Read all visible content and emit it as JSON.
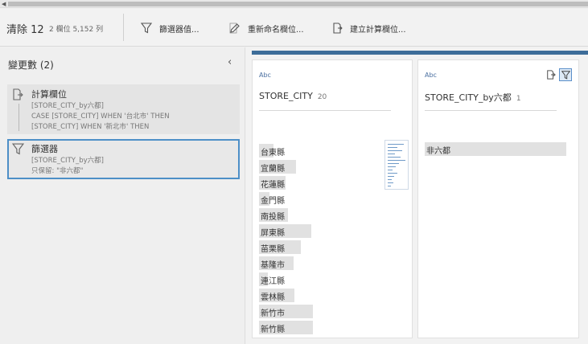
{
  "toolbar": {
    "title": "清除 12",
    "meta": "2 欄位  5,152 列",
    "buttons": [
      {
        "label": "篩選器值...",
        "icon": "funnel-icon"
      },
      {
        "label": "重新命名欄位...",
        "icon": "pencil-icon"
      },
      {
        "label": "建立計算欄位...",
        "icon": "calc-field-icon"
      }
    ]
  },
  "sidebar": {
    "title": "變更數 (2)",
    "collapse_glyph": "‹",
    "changes": [
      {
        "title": "計算欄位",
        "icon": "calc-field-icon",
        "lines": [
          "[STORE_CITY_by六都]",
          "CASE [STORE_CITY] WHEN '台北市' THEN",
          "[STORE_CITY] WHEN '新北市' THEN"
        ]
      },
      {
        "title": "篩選器",
        "icon": "funnel-icon",
        "lines": [
          "[STORE_CITY_by六都]",
          "只保留: \"非六都\""
        ]
      }
    ]
  },
  "columns": [
    {
      "type_label": "Abc",
      "name": "STORE_CITY",
      "count": "20",
      "rows": [
        {
          "label": "台東縣",
          "share": 0.16
        },
        {
          "label": "宜蘭縣",
          "share": 0.4
        },
        {
          "label": "花蓮縣",
          "share": 0.29
        },
        {
          "label": "金門縣",
          "share": 0.11
        },
        {
          "label": "南投縣",
          "share": 0.32
        },
        {
          "label": "屏東縣",
          "share": 0.57
        },
        {
          "label": "苗栗縣",
          "share": 0.46
        },
        {
          "label": "基隆市",
          "share": 0.38
        },
        {
          "label": "連江縣",
          "share": 0.1
        },
        {
          "label": "雲林縣",
          "share": 0.39
        },
        {
          "label": "新竹市",
          "share": 0.59
        },
        {
          "label": "新竹縣",
          "share": 0.59
        }
      ]
    },
    {
      "type_label": "Abc",
      "name": "STORE_CITY_by六都",
      "count": "1",
      "rows": [
        {
          "label": "非六都",
          "share": 1.0
        }
      ]
    }
  ],
  "colors": {
    "accent": "#3d6d99",
    "selection_border": "#4d8fc7",
    "bar": "#e1e1e1"
  }
}
